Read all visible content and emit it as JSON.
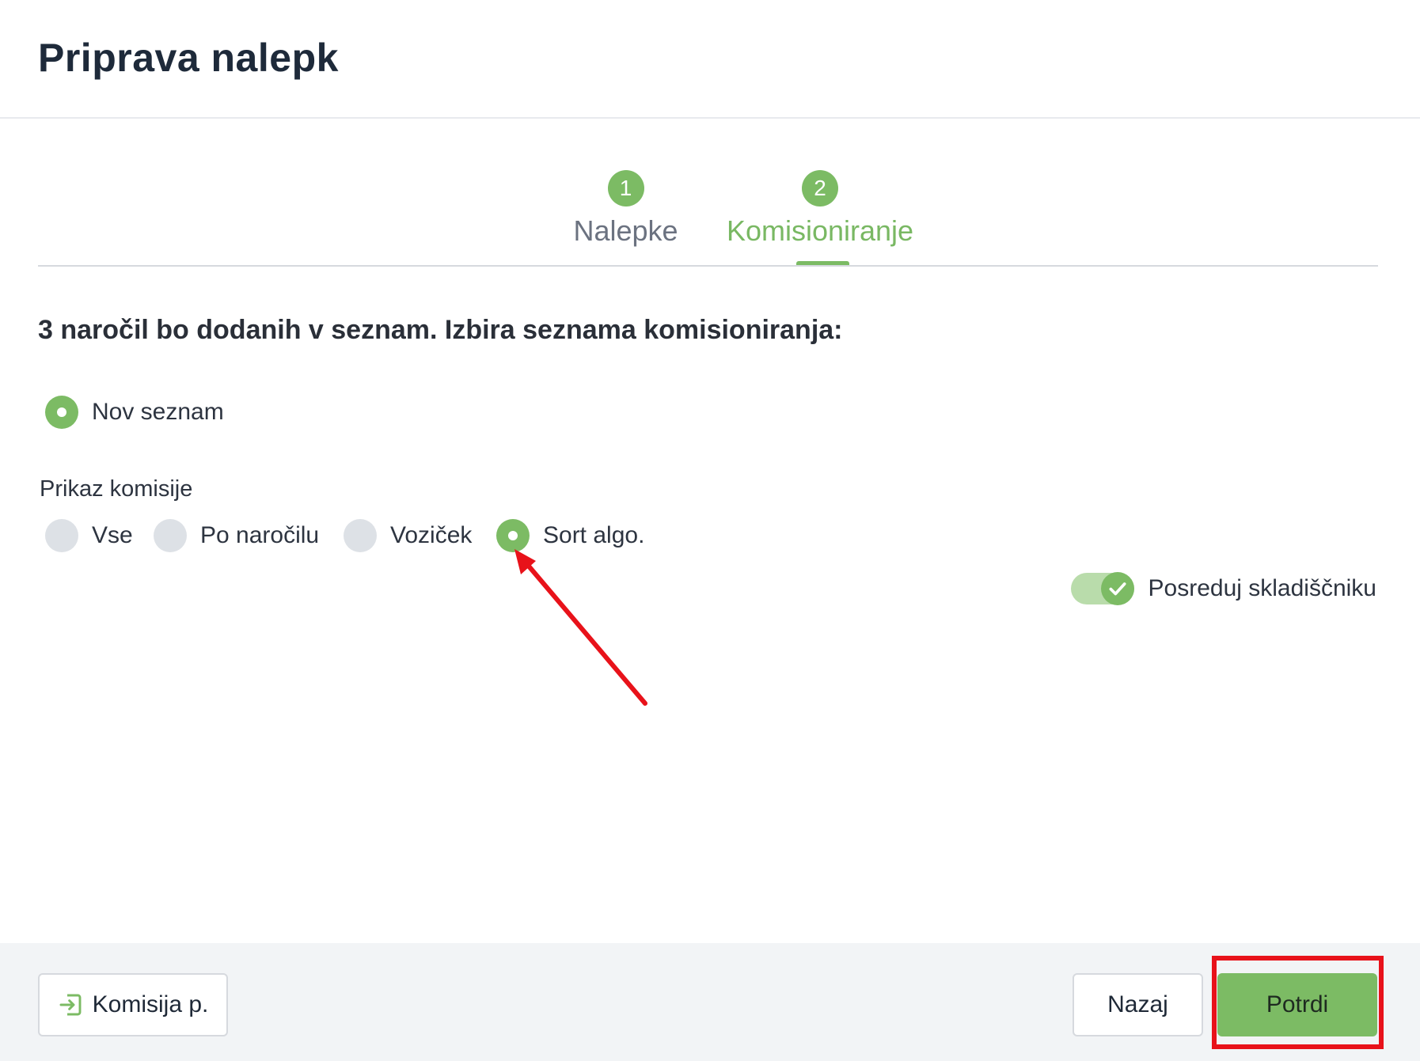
{
  "dialog": {
    "title": "Priprava nalepk"
  },
  "steps": [
    {
      "number": "1",
      "label": "Nalepke",
      "active": false
    },
    {
      "number": "2",
      "label": "Komisioniranje",
      "active": true
    }
  ],
  "question": "3 naročil bo dodanih v seznam. Izbira seznama komisioniranja:",
  "list_option": {
    "label": "Nov seznam",
    "selected": true
  },
  "display": {
    "label": "Prikaz komisije",
    "options": [
      {
        "label": "Vse",
        "selected": false
      },
      {
        "label": "Po naročilu",
        "selected": false
      },
      {
        "label": "Voziček",
        "selected": false
      },
      {
        "label": "Sort algo.",
        "selected": true
      }
    ]
  },
  "toggle": {
    "label": "Posreduj skladiščniku",
    "on": true
  },
  "footer": {
    "komisija_label": "Komisija p.",
    "back_label": "Nazaj",
    "confirm_label": "Potrdi"
  },
  "colors": {
    "accent": "#7cbb64",
    "annotation": "#e8121a"
  }
}
